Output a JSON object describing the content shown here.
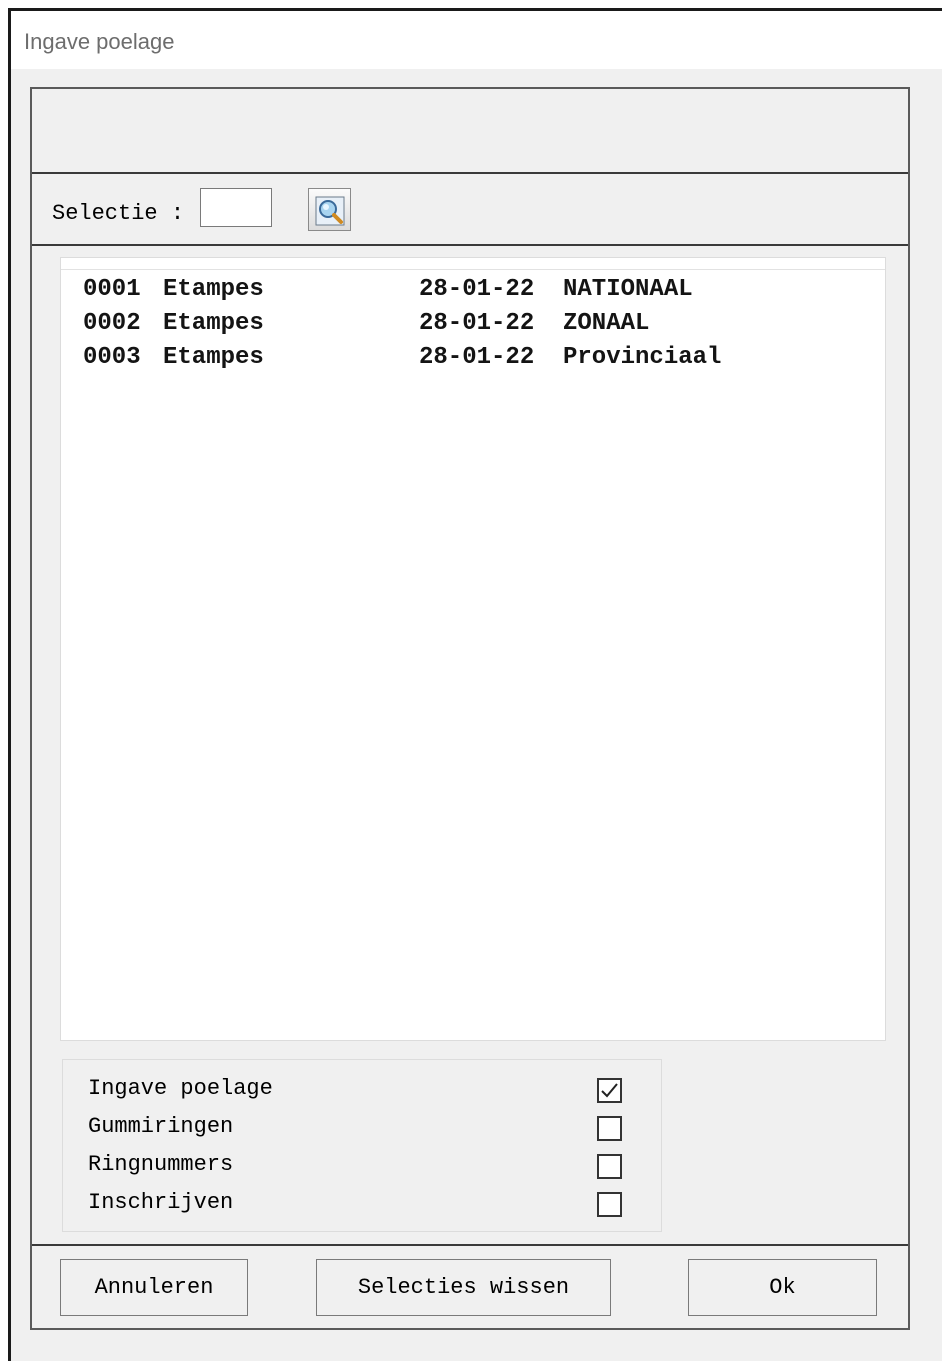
{
  "window": {
    "title": "Ingave poelage"
  },
  "selection": {
    "label": "Selectie :",
    "value": "",
    "search_icon": "magnifier-icon"
  },
  "list": {
    "rows": [
      {
        "code": "0001",
        "name": "Etampes",
        "date": "28-01-22",
        "category": "NATIONAAL"
      },
      {
        "code": "0002",
        "name": "Etampes",
        "date": "28-01-22",
        "category": "ZONAAL"
      },
      {
        "code": "0003",
        "name": "Etampes",
        "date": "28-01-22",
        "category": "Provinciaal"
      }
    ]
  },
  "options": [
    {
      "label": "Ingave poelage",
      "checked": true
    },
    {
      "label": "Gummiringen",
      "checked": false
    },
    {
      "label": "Ringnummers",
      "checked": false
    },
    {
      "label": "Inschrijven",
      "checked": false
    }
  ],
  "buttons": {
    "cancel": "Annuleren",
    "clear": "Selecties wissen",
    "ok": "Ok"
  }
}
